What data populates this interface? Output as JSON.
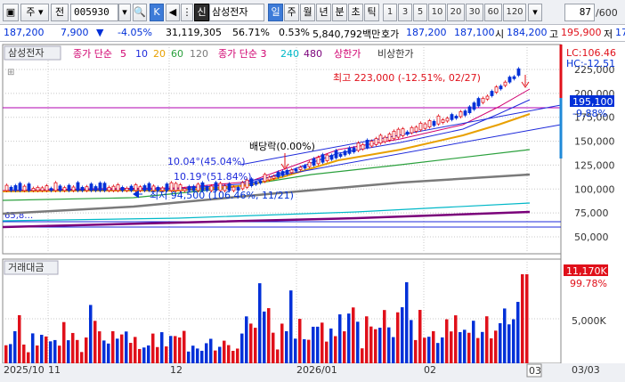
{
  "toolbar": {
    "period_select": "주",
    "prev_label": "전",
    "stock_code": "005930",
    "k_label": "K",
    "shin_label": "신",
    "stock_name": "삼성전자",
    "periods": [
      "일",
      "주",
      "월",
      "년",
      "분",
      "초",
      "틱"
    ],
    "active_period": "일",
    "intervals": [
      "1",
      "3",
      "5",
      "10",
      "20",
      "30",
      "60",
      "120"
    ],
    "page_counter": "87",
    "page_total": "/600"
  },
  "quote": {
    "price": "187,200",
    "change": "7,900",
    "change_pct": "-4.05%",
    "volume": "31,119,305",
    "turnover_pct": "56.71%",
    "rate": "0.53%",
    "amount": "5,840,792백만",
    "quote_label": "호가",
    "ask": "187,200",
    "bid": "187,100",
    "open_label": "시",
    "open": "184,200",
    "high_label": "고",
    "high": "195,900",
    "low_label": "저",
    "low": "17"
  },
  "price_pane": {
    "title": "삼성전자",
    "legend": {
      "ma_label": "종가 단순",
      "ma_periods": [
        "5",
        "10",
        "20",
        "60",
        "120"
      ],
      "ma_colors": [
        "#d0006f",
        "#1f2bdb",
        "#e8a000",
        "#2aa03c",
        "#7a7a7a"
      ],
      "bb_label": "종가 단순 3",
      "bb_periods": [
        "240",
        "480"
      ],
      "bb_colors": [
        "#00b8c8",
        "#7a007a"
      ],
      "upper_limit": "상한가",
      "non_upper": "비상한가"
    },
    "lc_label": "LC:106.46",
    "hc_label": "HC:-12.51",
    "current_price_tag": "195,100",
    "current_pct_tag": "-9.88%",
    "annotations": {
      "high": "최고 223,000 (-12.51%, 02/27)",
      "low": "최저 94,500 (106.46%, 11/21)",
      "dividend": "배당락(0.00%)",
      "trend1": "10.04°(45.04%)",
      "trend2": "10.19°(51.84%)",
      "base_line": "65,8…"
    },
    "y_ticks": [
      "225,000",
      "200,000",
      "175,000",
      "150,000",
      "125,000",
      "100,000",
      "75,000",
      "50,000"
    ]
  },
  "volume_pane": {
    "title": "거래대금",
    "value_tag": "11,170K",
    "pct_tag": "99.78%",
    "y_ticks": [
      "5,000K"
    ]
  },
  "x_axis": {
    "labels": [
      "2025/10",
      "11",
      "12",
      "2026/01",
      "02",
      "03"
    ],
    "right_label": "03/03"
  },
  "colors": {
    "up": "#e0101a",
    "down": "#0030d8",
    "accent": "#3d7bd8",
    "limit_line": "#b000b0"
  }
}
